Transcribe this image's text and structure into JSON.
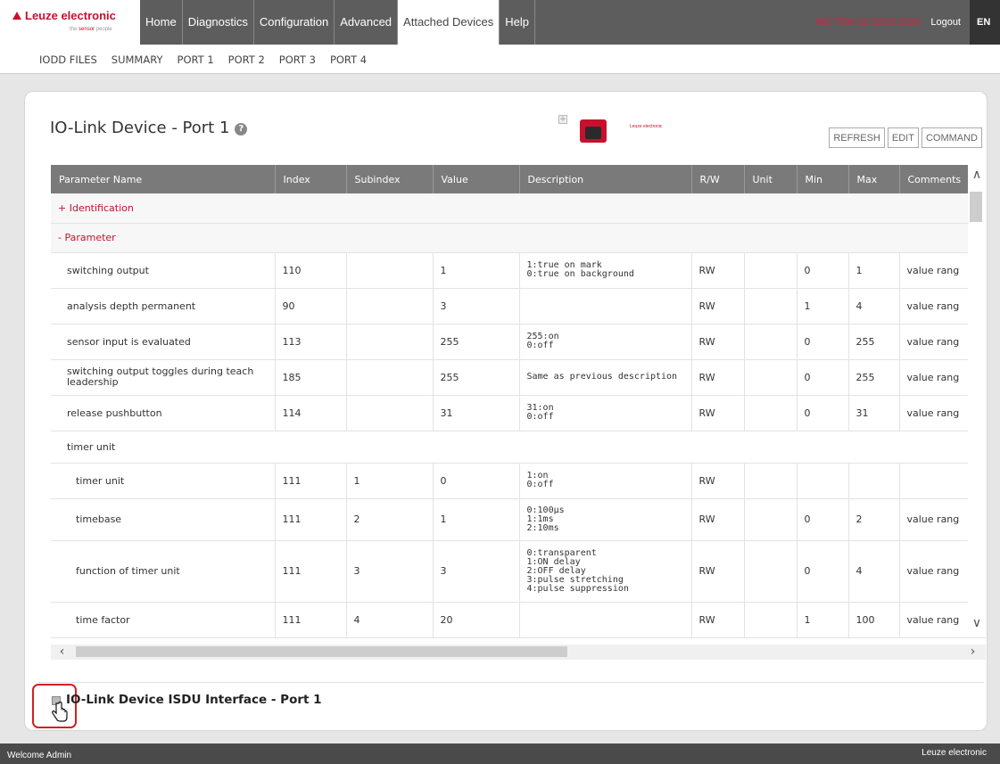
{
  "header": {
    "logo": "Leuze electronic",
    "logo_tagline_pre": "the ",
    "logo_tagline_red": "sensor",
    "logo_tagline_post": " people",
    "device_info": "MD 7990 11 03/13 2023",
    "logout": "Logout",
    "language": "EN",
    "nav": [
      {
        "label": "Home"
      },
      {
        "label": "Diagnostics"
      },
      {
        "label": "Configuration"
      },
      {
        "label": "Advanced"
      },
      {
        "label": "Attached Devices"
      },
      {
        "label": "Help"
      }
    ]
  },
  "subnav": [
    "IODD FILES",
    "SUMMARY",
    "PORT 1",
    "PORT 2",
    "PORT 3",
    "PORT 4"
  ],
  "panel": {
    "title": "IO-Link Device - Port 1",
    "help_icon": "question-icon",
    "device_logo_text": "Leuze electronic",
    "buttons": [
      "REFRESH",
      "EDIT",
      "COMMAND"
    ]
  },
  "table": {
    "columns": [
      "Parameter Name",
      "Index",
      "Subindex",
      "Value",
      "Description",
      "R/W",
      "Unit",
      "Min",
      "Max",
      "Comments"
    ],
    "groups": {
      "identification": "+ Identification",
      "parameter": "- Parameter",
      "timer_unit": "timer unit"
    },
    "rows": [
      {
        "name": "switching output",
        "index": "110",
        "subindex": "",
        "value": "1",
        "description": "1:true on mark\n0:true on background",
        "rw": "RW",
        "unit": "",
        "min": "0",
        "max": "1",
        "comments": "value rang"
      },
      {
        "name": "analysis depth permanent",
        "index": "90",
        "subindex": "",
        "value": "3",
        "description": "",
        "rw": "RW",
        "unit": "",
        "min": "1",
        "max": "4",
        "comments": "value rang"
      },
      {
        "name": "sensor input is evaluated",
        "index": "113",
        "subindex": "",
        "value": "255",
        "description": "255:on\n0:off",
        "rw": "RW",
        "unit": "",
        "min": "0",
        "max": "255",
        "comments": "value rang"
      },
      {
        "name": "switching output toggles during teach leadership",
        "index": "185",
        "subindex": "",
        "value": "255",
        "description": "Same as previous description",
        "rw": "RW",
        "unit": "",
        "min": "0",
        "max": "255",
        "comments": "value rang"
      },
      {
        "name": "release pushbutton",
        "index": "114",
        "subindex": "",
        "value": "31",
        "description": "31:on\n0:off",
        "rw": "RW",
        "unit": "",
        "min": "0",
        "max": "31",
        "comments": "value rang"
      }
    ],
    "timer_rows": [
      {
        "name": "timer unit",
        "index": "111",
        "subindex": "1",
        "value": "0",
        "description": "1:on\n0:off",
        "rw": "RW",
        "unit": "",
        "min": "",
        "max": "",
        "comments": ""
      },
      {
        "name": "timebase",
        "index": "111",
        "subindex": "2",
        "value": "1",
        "description": "0:100µs\n1:1ms\n2:10ms",
        "rw": "RW",
        "unit": "",
        "min": "0",
        "max": "2",
        "comments": "value rang"
      },
      {
        "name": "function of timer unit",
        "index": "111",
        "subindex": "3",
        "value": "3",
        "description": "0:transparent\n1:ON delay\n2:OFF delay\n3:pulse stretching\n4:pulse suppression",
        "rw": "RW",
        "unit": "",
        "min": "0",
        "max": "4",
        "comments": "value rang"
      },
      {
        "name": "time factor",
        "index": "111",
        "subindex": "4",
        "value": "20",
        "description": "",
        "rw": "RW",
        "unit": "",
        "min": "1",
        "max": "100",
        "comments": "value rang"
      }
    ]
  },
  "isdu": {
    "title": "IO-Link Device ISDU Interface - Port 1"
  },
  "footer": {
    "welcome": "Welcome Admin",
    "brand": "Leuze electronic"
  }
}
